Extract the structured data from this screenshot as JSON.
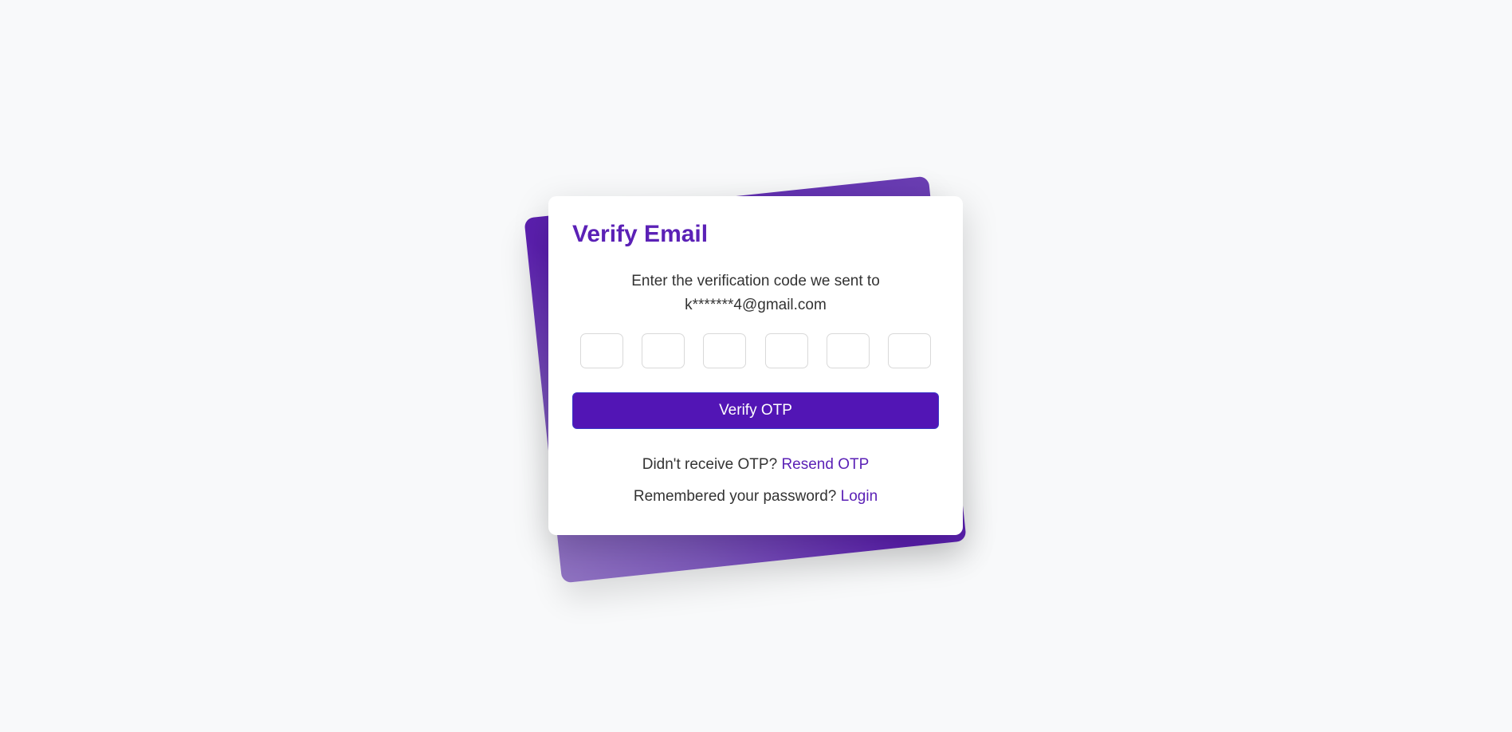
{
  "card": {
    "title": "Verify Email",
    "description_line1": "Enter the verification code we sent to",
    "description_line2": "k*******4@gmail.com",
    "otp_boxes": [
      "",
      "",
      "",
      "",
      "",
      ""
    ],
    "verify_label": "Verify OTP",
    "resend_prompt": "Didn't receive OTP?",
    "resend_link": "Resend OTP",
    "login_prompt": "Remembered your password?",
    "login_link": "Login"
  },
  "colors": {
    "accent": "#5b21b6",
    "button": "#5215b5",
    "background": "#f8f9fa"
  }
}
